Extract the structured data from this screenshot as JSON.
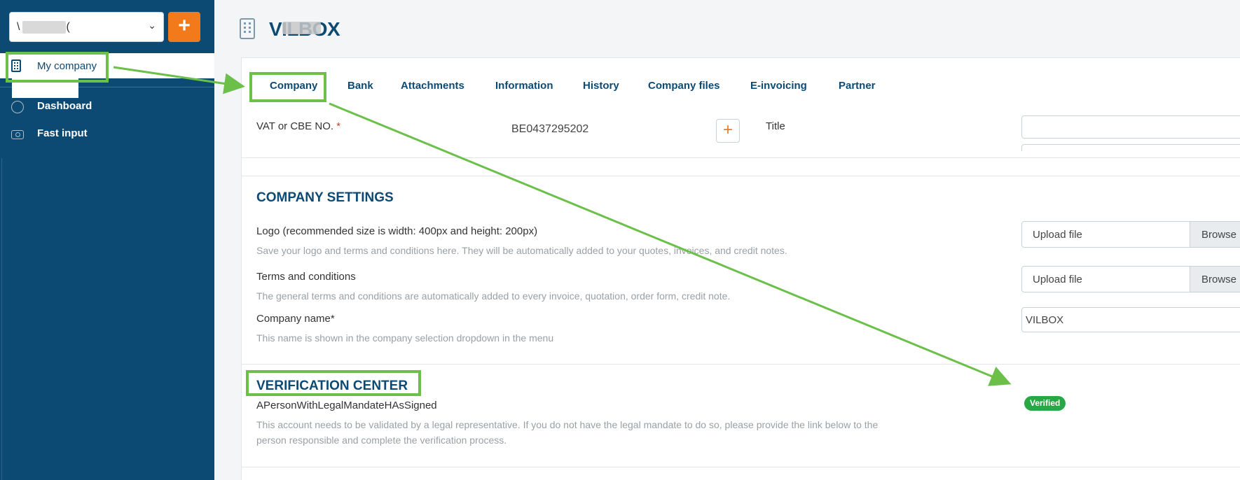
{
  "sidebar": {
    "company_select": {
      "value_prefix": "\\",
      "value_suffix": "(",
      "chevron": "chevron-down-icon"
    },
    "add_button": "+",
    "active_item": {
      "label": "My company",
      "icon": "building-icon"
    },
    "items": [
      {
        "label": "Dashboard",
        "icon": "gauge-icon"
      },
      {
        "label": "Fast input",
        "icon": "camera-icon"
      }
    ]
  },
  "header": {
    "title": "VILBOX",
    "icon": "building-icon"
  },
  "tabs": [
    {
      "label": "Company",
      "active": true
    },
    {
      "label": "Bank"
    },
    {
      "label": "Attachments"
    },
    {
      "label": "Information"
    },
    {
      "label": "History"
    },
    {
      "label": "Company files"
    },
    {
      "label": "E-invoicing"
    },
    {
      "label": "Partner"
    }
  ],
  "vat_row": {
    "label": "VAT or CBE NO.",
    "required_mark": "*",
    "value": "BE0437295202",
    "add_button": "+",
    "title_label": "Title"
  },
  "company_settings": {
    "title": "COMPANY SETTINGS",
    "logo": {
      "label": "Logo (recommended size is width: 400px and height: 200px)",
      "help": "Save your logo and terms and conditions here. They will be automatically added to your quotes, invoices, and credit notes.",
      "upload_placeholder": "Upload file",
      "browse": "Browse"
    },
    "terms": {
      "label": "Terms and conditions",
      "help": "The general terms and conditions are automatically added to every invoice, quotation, order form, credit note.",
      "upload_placeholder": "Upload file",
      "browse": "Browse"
    },
    "company_name": {
      "label": "Company name*",
      "help": "This name is shown in the company selection dropdown in the menu",
      "value": "VILBOX"
    }
  },
  "verification_center": {
    "title": "VERIFICATION CENTER",
    "item_label": "APersonWithLegalMandateHAsSigned",
    "help_line1": "This account needs to be validated by a legal representative. If you do not have the legal mandate to do so, please provide the link below to the",
    "help_line2": "person responsible and complete the verification process.",
    "badge": "Verified"
  },
  "colors": {
    "sidebar": "#0d4a73",
    "accent": "#f27a1a",
    "primary_text": "#0d4a73",
    "highlight": "#6cc04a",
    "verified": "#28a745"
  }
}
